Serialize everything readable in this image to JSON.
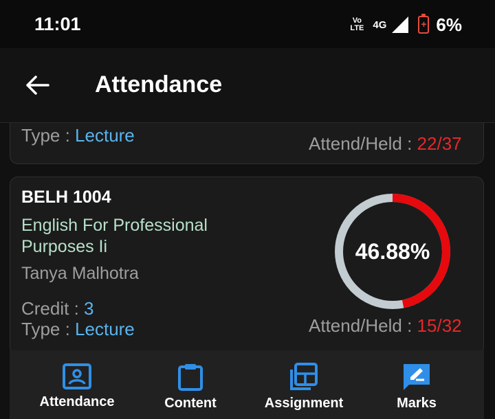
{
  "status": {
    "time": "11:01",
    "volte": "Vo LTE",
    "network": "4G",
    "battery": "6%"
  },
  "header": {
    "title": "Attendance"
  },
  "cards": [
    {
      "type_label": "Type : ",
      "type_value": "Lecture",
      "attend_label": "Attend/Held : ",
      "attend_value": "22/37"
    },
    {
      "code": "BELH 1004",
      "subject": "English For Professional Purposes Ii",
      "teacher": "Tanya Malhotra",
      "credit_label": "Credit : ",
      "credit_value": "3",
      "type_label": "Type : ",
      "type_value": "Lecture",
      "percent": "46.88%",
      "percent_value": 46.88,
      "attend_label": "Attend/Held : ",
      "attend_value": "15/32"
    }
  ],
  "nav": {
    "attendance": "Attendance",
    "content": "Content",
    "assignment": "Assignment",
    "marks": "Marks"
  },
  "colors": {
    "accent_blue": "#2f8fe8",
    "ring_red": "#e6090e",
    "ring_track": "#c2ccd1",
    "subject_green": "#b7e0c9"
  }
}
